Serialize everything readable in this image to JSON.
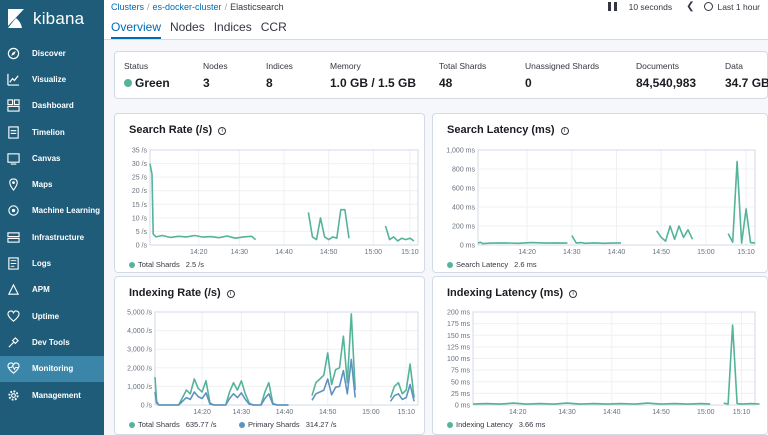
{
  "brand": {
    "name": "kibana"
  },
  "sidebar": {
    "items": [
      {
        "label": "Discover",
        "icon": "compass-icon"
      },
      {
        "label": "Visualize",
        "icon": "visualize-icon"
      },
      {
        "label": "Dashboard",
        "icon": "dashboard-icon"
      },
      {
        "label": "Timelion",
        "icon": "timelion-icon"
      },
      {
        "label": "Canvas",
        "icon": "canvas-icon"
      },
      {
        "label": "Maps",
        "icon": "maps-icon"
      },
      {
        "label": "Machine Learning",
        "icon": "machine-learning-icon"
      },
      {
        "label": "Infrastructure",
        "icon": "infrastructure-icon"
      },
      {
        "label": "Logs",
        "icon": "logs-icon"
      },
      {
        "label": "APM",
        "icon": "apm-icon"
      },
      {
        "label": "Uptime",
        "icon": "uptime-icon"
      },
      {
        "label": "Dev Tools",
        "icon": "dev-tools-icon"
      },
      {
        "label": "Monitoring",
        "icon": "monitoring-icon",
        "active": true
      },
      {
        "label": "Management",
        "icon": "gear-icon"
      }
    ]
  },
  "breadcrumb": {
    "items": [
      "Clusters",
      "es-docker-cluster",
      "Elasticsearch"
    ]
  },
  "tabs": [
    "Overview",
    "Nodes",
    "Indices",
    "CCR"
  ],
  "time_controls": {
    "refresh_interval": "10 seconds",
    "time_range": "Last 1 hour"
  },
  "summary": {
    "status": {
      "label": "Status",
      "value": "Green"
    },
    "nodes": {
      "label": "Nodes",
      "value": "3"
    },
    "indices": {
      "label": "Indices",
      "value": "8"
    },
    "memory": {
      "label": "Memory",
      "value": "1.0 GB / 1.5 GB"
    },
    "total_shards": {
      "label": "Total Shards",
      "value": "48"
    },
    "unassigned_shards": {
      "label": "Unassigned Shards",
      "value": "0"
    },
    "documents": {
      "label": "Documents",
      "value": "84,540,983"
    },
    "data": {
      "label": "Data",
      "value": "34.7 GB"
    }
  },
  "colors": {
    "sidebar": "#1e5c7a",
    "accent": "#006bb4",
    "series1": "#54b399",
    "series2": "#6092c0"
  },
  "chart_data": [
    {
      "type": "line",
      "title": "Search Rate (/s)",
      "yticks": [
        "0 /s",
        "5 /s",
        "10 /s",
        "15 /s",
        "20 /s",
        "25 /s",
        "30 /s",
        "35 /s"
      ],
      "ylim": [
        0,
        35
      ],
      "xticks": [
        "14:20",
        "14:30",
        "14:40",
        "14:50",
        "15:00",
        "15:10"
      ],
      "series": [
        {
          "name": "Total Shards",
          "legend_value": "2.5 /s",
          "segments": [
            [
              [
                0,
                30
              ],
              [
                0.5,
                26
              ],
              [
                0.8,
                4
              ],
              [
                1.5,
                3
              ],
              [
                3,
                3.5
              ],
              [
                5,
                2.8
              ],
              [
                7,
                3.2
              ],
              [
                9,
                3
              ],
              [
                11,
                3.5
              ],
              [
                13,
                2.9
              ],
              [
                15,
                3.1
              ],
              [
                17,
                2.7
              ],
              [
                19,
                3.3
              ],
              [
                21,
                2.5
              ],
              [
                23,
                3
              ],
              [
                25,
                3.2
              ],
              [
                26,
                2
              ]
            ],
            [
              [
                39,
                12
              ],
              [
                40,
                3
              ],
              [
                41,
                2
              ],
              [
                42,
                10
              ],
              [
                43,
                3
              ],
              [
                44,
                2
              ],
              [
                45,
                3
              ],
              [
                46,
                2.5
              ],
              [
                47,
                13
              ],
              [
                48,
                13
              ],
              [
                49,
                2.5
              ]
            ],
            [
              [
                58,
                7
              ],
              [
                59,
                2
              ],
              [
                60,
                3
              ],
              [
                61,
                1.5
              ],
              [
                62,
                2.5
              ],
              [
                63,
                2
              ],
              [
                64,
                2.5
              ],
              [
                65,
                1.5
              ]
            ]
          ]
        }
      ]
    },
    {
      "type": "line",
      "title": "Search Latency (ms)",
      "yticks": [
        "0 ms",
        "200 ms",
        "400 ms",
        "600 ms",
        "800 ms",
        "1,000 ms"
      ],
      "ylim": [
        0,
        1000
      ],
      "xticks": [
        "14:20",
        "14:30",
        "14:40",
        "14:50",
        "15:00",
        "15:10"
      ],
      "series": [
        {
          "name": "Search Latency",
          "legend_value": "2.6 ms",
          "segments": [
            [
              [
                0,
                20
              ],
              [
                0.5,
                30
              ],
              [
                1,
                15
              ],
              [
                3,
                20
              ],
              [
                6,
                22
              ],
              [
                9,
                18
              ],
              [
                12,
                25
              ],
              [
                15,
                20
              ],
              [
                18,
                22
              ],
              [
                20,
                20
              ]
            ],
            [
              [
                21,
                100
              ],
              [
                22,
                20
              ],
              [
                23,
                25
              ],
              [
                24,
                18
              ],
              [
                25,
                20
              ],
              [
                26,
                22
              ],
              [
                27,
                20
              ],
              [
                28,
                18
              ],
              [
                30,
                20
              ],
              [
                32,
                22
              ]
            ],
            [
              [
                40,
                150
              ],
              [
                41,
                80
              ],
              [
                42,
                40
              ],
              [
                43,
                200
              ],
              [
                44,
                60
              ],
              [
                45,
                200
              ],
              [
                46,
                80
              ],
              [
                47,
                160
              ],
              [
                48,
                60
              ]
            ],
            [
              [
                56,
                120
              ],
              [
                57,
                30
              ],
              [
                58,
                880
              ],
              [
                59,
                20
              ],
              [
                60,
                380
              ],
              [
                61,
                25
              ],
              [
                62,
                20
              ]
            ]
          ]
        }
      ]
    },
    {
      "type": "line",
      "title": "Indexing Rate (/s)",
      "yticks": [
        "0 /s",
        "1,000 /s",
        "2,000 /s",
        "3,000 /s",
        "4,000 /s",
        "5,000 /s"
      ],
      "ylim": [
        0,
        5000
      ],
      "xticks": [
        "14:20",
        "14:30",
        "14:40",
        "14:50",
        "15:00",
        "15:10"
      ],
      "series": [
        {
          "name": "Total Shards",
          "legend_value": "635.77 /s",
          "segments": [
            [
              [
                0,
                1500
              ],
              [
                0.4,
                200
              ],
              [
                1,
                0
              ],
              [
                6,
                0
              ],
              [
                7,
                400
              ],
              [
                8,
                800
              ],
              [
                9,
                600
              ],
              [
                10,
                1400
              ],
              [
                11,
                900
              ],
              [
                12,
                700
              ],
              [
                13,
                1300
              ],
              [
                14,
                100
              ],
              [
                15,
                0
              ],
              [
                18,
                0
              ],
              [
                19,
                700
              ],
              [
                20,
                1200
              ],
              [
                21,
                800
              ],
              [
                22,
                1300
              ],
              [
                23,
                600
              ],
              [
                24,
                100
              ],
              [
                25,
                0
              ],
              [
                27,
                0
              ],
              [
                28,
                700
              ],
              [
                29,
                1200
              ],
              [
                30,
                100
              ],
              [
                31,
                0
              ],
              [
                34,
                0
              ]
            ],
            [
              [
                40,
                500
              ],
              [
                41,
                1200
              ],
              [
                42,
                1400
              ],
              [
                43,
                1600
              ],
              [
                44,
                2800
              ],
              [
                45,
                1100
              ],
              [
                46,
                1900
              ],
              [
                47,
                2000
              ],
              [
                48,
                3700
              ],
              [
                49,
                1200
              ],
              [
                50,
                4900
              ],
              [
                51,
                800
              ]
            ],
            [
              [
                60,
                400
              ],
              [
                61,
                1000
              ],
              [
                62,
                1200
              ],
              [
                63,
                600
              ],
              [
                64,
                800
              ],
              [
                65,
                2200
              ],
              [
                66,
                400
              ]
            ]
          ]
        },
        {
          "name": "Primary Shards",
          "legend_value": "314.27 /s",
          "segments": [
            [
              [
                0,
                700
              ],
              [
                0.4,
                100
              ],
              [
                1,
                0
              ],
              [
                6,
                0
              ],
              [
                7,
                200
              ],
              [
                8,
                400
              ],
              [
                9,
                300
              ],
              [
                10,
                700
              ],
              [
                11,
                450
              ],
              [
                12,
                350
              ],
              [
                13,
                650
              ],
              [
                14,
                50
              ],
              [
                15,
                0
              ],
              [
                18,
                0
              ],
              [
                19,
                350
              ],
              [
                20,
                600
              ],
              [
                21,
                400
              ],
              [
                22,
                650
              ],
              [
                23,
                300
              ],
              [
                24,
                50
              ],
              [
                25,
                0
              ],
              [
                27,
                0
              ],
              [
                28,
                350
              ],
              [
                29,
                600
              ],
              [
                30,
                50
              ],
              [
                31,
                0
              ],
              [
                34,
                0
              ]
            ],
            [
              [
                40,
                250
              ],
              [
                41,
                600
              ],
              [
                42,
                700
              ],
              [
                43,
                800
              ],
              [
                44,
                1400
              ],
              [
                45,
                550
              ],
              [
                46,
                950
              ],
              [
                47,
                1000
              ],
              [
                48,
                1850
              ],
              [
                49,
                600
              ],
              [
                50,
                2450
              ],
              [
                51,
                400
              ]
            ],
            [
              [
                60,
                200
              ],
              [
                61,
                500
              ],
              [
                62,
                600
              ],
              [
                63,
                300
              ],
              [
                64,
                400
              ],
              [
                65,
                1100
              ],
              [
                66,
                200
              ]
            ]
          ]
        }
      ]
    },
    {
      "type": "line",
      "title": "Indexing Latency (ms)",
      "yticks": [
        "0 ms",
        "25 ms",
        "50 ms",
        "75 ms",
        "100 ms",
        "125 ms",
        "150 ms",
        "175 ms",
        "200 ms"
      ],
      "ylim": [
        0,
        200
      ],
      "xticks": [
        "14:20",
        "14:30",
        "14:40",
        "14:50",
        "15:00",
        "15:10"
      ],
      "series": [
        {
          "name": "Indexing Latency",
          "legend_value": "3.66 ms",
          "segments": [
            [
              [
                0,
                2
              ],
              [
                3,
                3
              ],
              [
                6,
                2
              ],
              [
                9,
                4
              ],
              [
                12,
                2
              ],
              [
                15,
                3
              ],
              [
                18,
                2
              ],
              [
                21,
                4
              ],
              [
                24,
                2
              ],
              [
                27,
                3
              ],
              [
                30,
                2
              ],
              [
                33,
                3
              ],
              [
                36,
                2
              ],
              [
                39,
                4
              ],
              [
                42,
                2
              ],
              [
                45,
                3
              ],
              [
                48,
                2
              ],
              [
                51,
                3
              ],
              [
                53,
                2
              ]
            ],
            [
              [
                56,
                4
              ],
              [
                57,
                2
              ],
              [
                58,
                172
              ],
              [
                59,
                3
              ],
              [
                60,
                2
              ],
              [
                62,
                3
              ],
              [
                64,
                2
              ]
            ]
          ]
        }
      ]
    }
  ]
}
